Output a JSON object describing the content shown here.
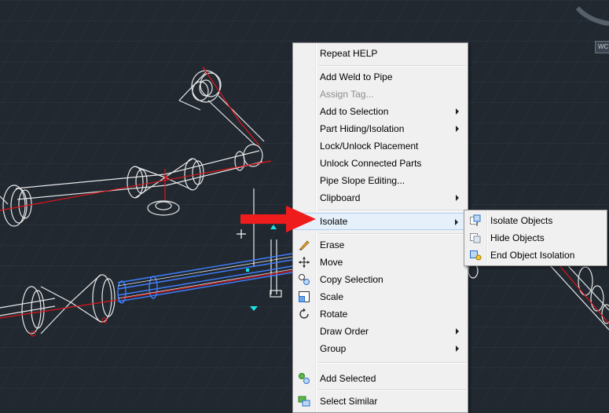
{
  "canvas": {
    "background": "#212830",
    "grid_color": "#2c3540",
    "wire_color": "#e8e8e8",
    "pipe_centerline_color": "#e0151b",
    "selection_color": "#3f7fff"
  },
  "viewcube": {
    "badge": "WC"
  },
  "context_menu": {
    "items": [
      {
        "label": "Repeat HELP"
      },
      {
        "label": "Add Weld to Pipe"
      },
      {
        "label": "Assign Tag..."
      },
      {
        "label": "Add to Selection"
      },
      {
        "label": "Part Hiding/Isolation"
      },
      {
        "label": "Lock/Unlock Placement"
      },
      {
        "label": "Unlock Connected Parts"
      },
      {
        "label": "Pipe Slope Editing..."
      },
      {
        "label": "Clipboard"
      },
      {
        "label": "Isolate"
      },
      {
        "label": "Erase",
        "icon": "eraser-icon"
      },
      {
        "label": "Move",
        "icon": "move-icon"
      },
      {
        "label": "Copy Selection",
        "icon": "copy-icon"
      },
      {
        "label": "Scale",
        "icon": "scale-icon"
      },
      {
        "label": "Rotate",
        "icon": "rotate-icon"
      },
      {
        "label": "Draw Order"
      },
      {
        "label": "Group"
      },
      {
        "label": "Add Selected",
        "icon": "add-selected-icon"
      },
      {
        "label": "Select Similar",
        "icon": "select-similar-icon"
      }
    ],
    "disabled_item": "Assign Tag...",
    "highlighted_item": "Isolate"
  },
  "isolate_submenu": {
    "items": [
      {
        "label": "Isolate Objects",
        "icon": "isolate-objects-icon"
      },
      {
        "label": "Hide Objects",
        "icon": "hide-objects-icon"
      },
      {
        "label": "End Object Isolation",
        "icon": "end-isolation-icon"
      }
    ]
  },
  "pointer_arrow_color": "#ee1c1c"
}
